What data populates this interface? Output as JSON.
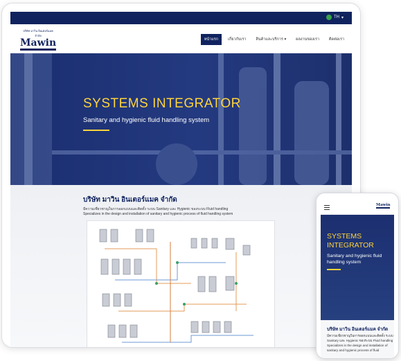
{
  "topbar": {
    "language": "TH"
  },
  "logo": {
    "tagline": "บริษัท มาวิน อินเตอร์แมค จำกัด",
    "name": "Mawin",
    "subtitle": "INTERMAC CO.,LTD"
  },
  "nav": {
    "items": [
      "หน้าแรก",
      "เกี่ยวกับเรา",
      "สินค้าและบริการ",
      "ผลงานของเรา",
      "ติดต่อเรา"
    ]
  },
  "hero": {
    "title": "SYSTEMS INTEGRATOR",
    "subtitle": "Sanitary and hygienic fluid handling system"
  },
  "about": {
    "heading": "บริษัท มาวิน อินเตอร์แมค จำกัด",
    "desc_th": "มีความเชี่ยวชาญในการออกแบบและติดตั้ง ระบบ Sanitary และ Hygienic ของระบบ Fluid handling",
    "desc_en": "Specializes in the design and installation of sanitary and hygienic process of fluid handling system"
  },
  "mobile": {
    "hero_title": "SYSTEMS INTEGRATOR",
    "hero_subtitle": "Sanitary and hygienic fluid handling system",
    "about_heading": "บริษัท มาวิน อินเตอร์แมค จำกัด",
    "about_lines": [
      "มีความเชี่ยวชาญในการออกแบบและติดตั้ง ระบบ",
      "Sanitary และ Hygienic ของระบบ Fluid handling",
      "Specializes in the design and installation of",
      "sanitary and hygienic process of fluid"
    ]
  },
  "colors": {
    "primary": "#10235f",
    "accent": "#ffd43a"
  }
}
